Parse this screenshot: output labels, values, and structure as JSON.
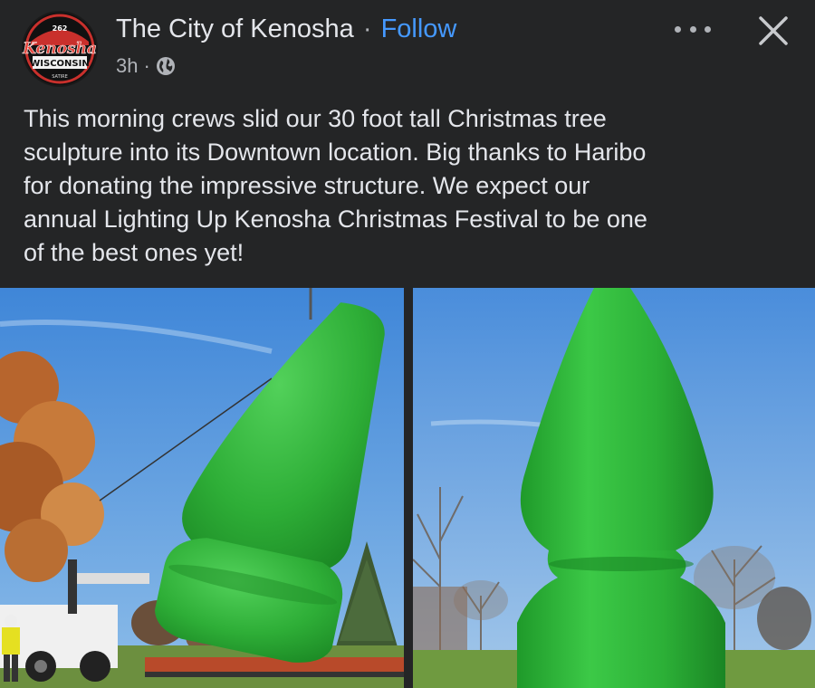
{
  "header": {
    "page_name": "The City of Kenosha",
    "separator": "·",
    "follow_label": "Follow",
    "timestamp": "3h",
    "timestamp_separator": "·",
    "audience_icon": "globe-icon",
    "more_icon": "more-horizontal-icon",
    "close_icon": "close-icon"
  },
  "avatar": {
    "logo_number": "262",
    "logo_city": "Kenosha",
    "logo_state": "WISCONSIN",
    "logo_bottom": "SATIRE"
  },
  "post": {
    "text": "This morning crews slid our 30 foot tall Christmas tree\nsculpture into its Downtown location.  Big thanks to Haribo\nfor donating the impressive structure.  We expect our\nannual Lighting Up Kenosha Christmas Festival to be one\nof the best ones yet!"
  },
  "colors": {
    "background": "#242526",
    "text": "#e4e6eb",
    "secondary_text": "#b0b3b8",
    "link": "#4599ff",
    "sculpture_green": "#2fb53a",
    "sky": "#5fa0e0"
  }
}
